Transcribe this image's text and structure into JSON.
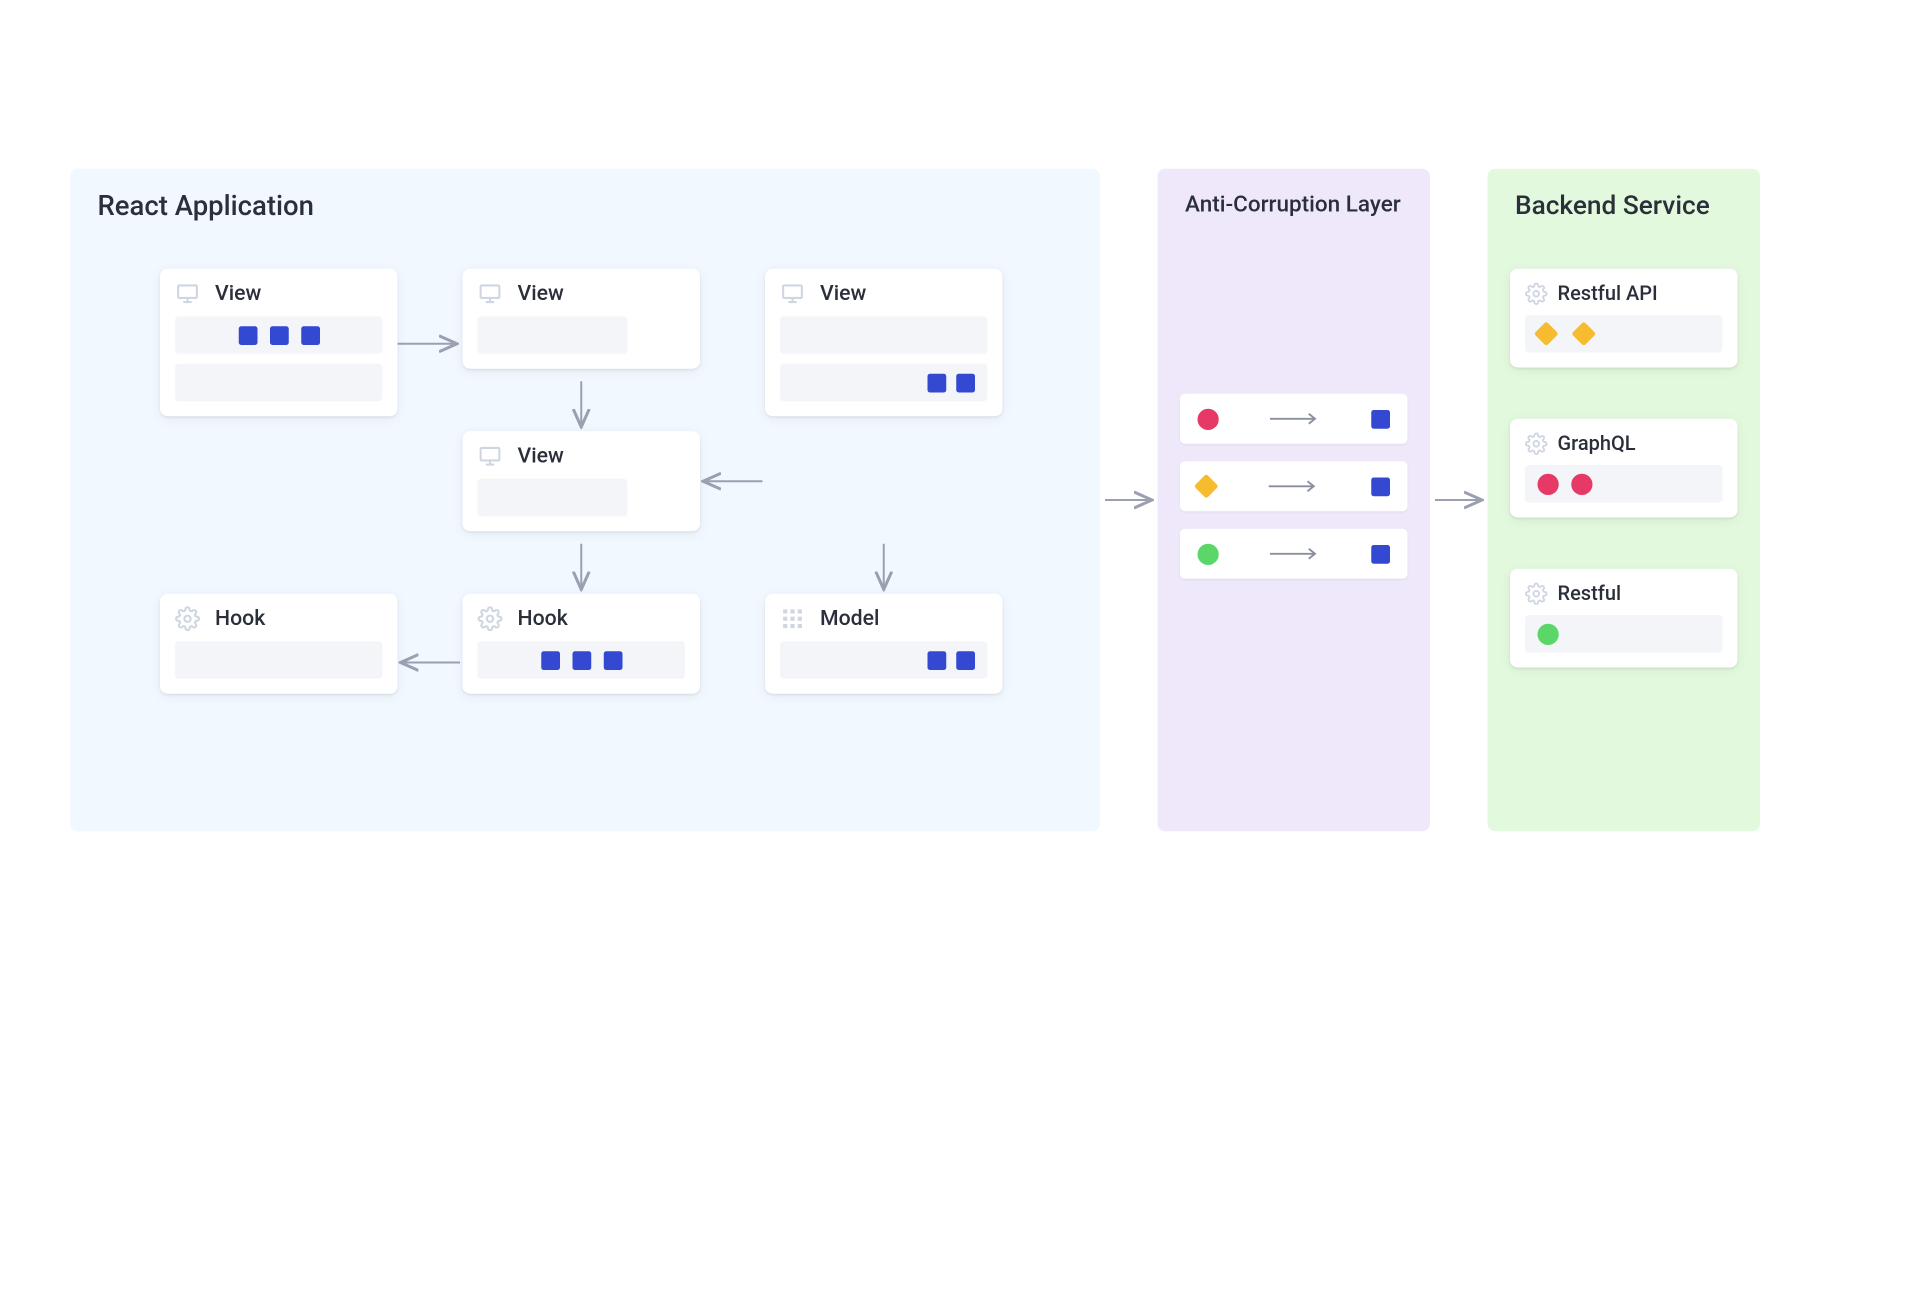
{
  "panels": {
    "react": "React Application",
    "acl": "Anti-Corruption Layer",
    "backend": "Backend Service"
  },
  "react_cards": {
    "view1": "View",
    "view2": "View",
    "view3": "View",
    "view4": "View",
    "hook1": "Hook",
    "hook2": "Hook",
    "model": "Model"
  },
  "backend_cards": {
    "restful_api": "Restful API",
    "graphql": "GraphQL",
    "restful": "Restful"
  },
  "colors": {
    "square_blue": "#3349d1",
    "circle_red": "#e73965",
    "circle_green": "#5bd76a",
    "diamond_yellow": "#f7bb2f",
    "panel_react": "#f1f8ff",
    "panel_acl": "#efe8fb",
    "panel_backend": "#e3f9de",
    "stripe": "#f3f5f8"
  },
  "icons": {
    "monitor": "monitor-icon",
    "gear": "gear-icon",
    "grid": "grid-icon"
  }
}
